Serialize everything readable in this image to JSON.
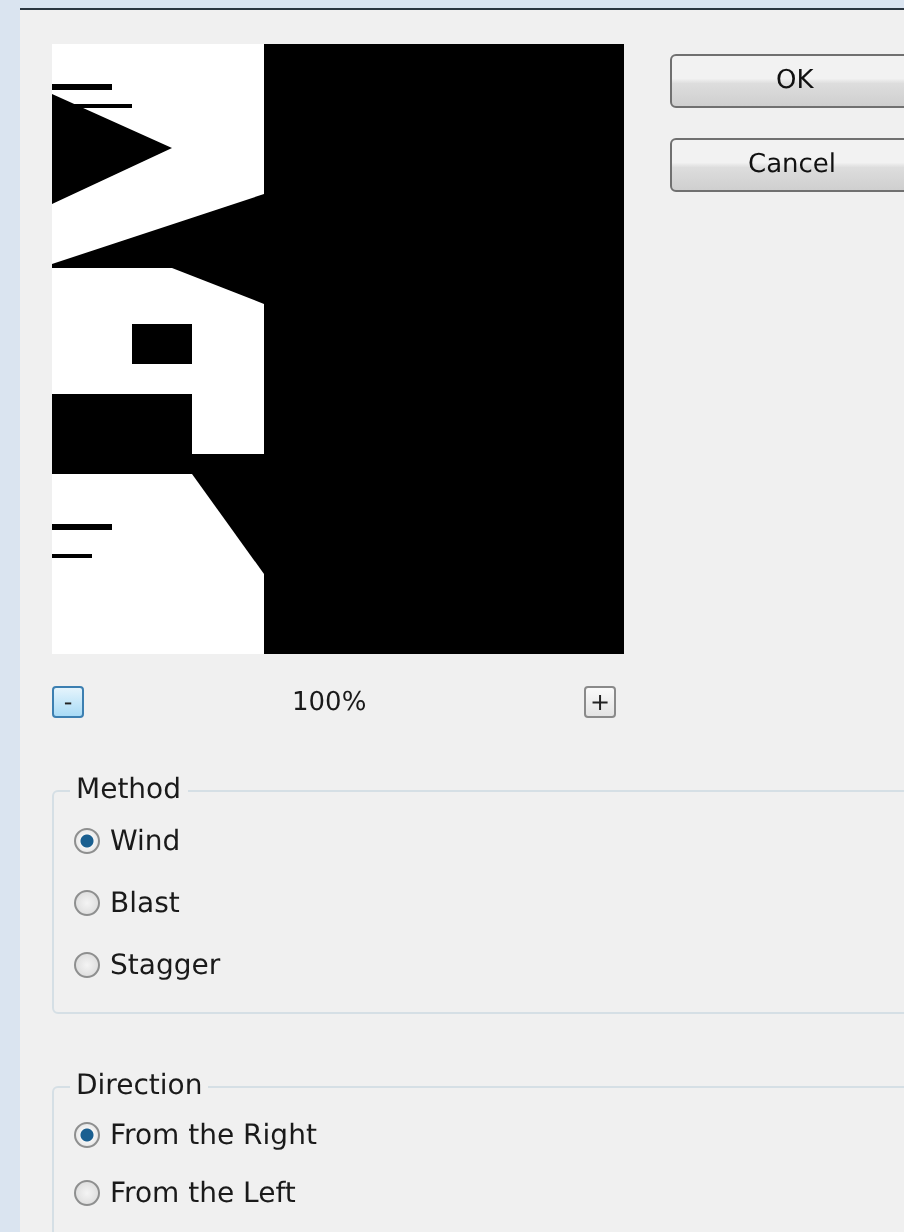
{
  "zoom": {
    "minus": {
      "label": "-",
      "highlighted": true
    },
    "value": "100%",
    "plus": {
      "label": "+",
      "highlighted": false
    }
  },
  "buttons": [
    {
      "label": "OK"
    },
    {
      "label": "Cancel"
    }
  ],
  "groups": [
    {
      "title": "Method",
      "options": [
        {
          "label": "Wind",
          "selected": true
        },
        {
          "label": "Blast",
          "selected": false
        },
        {
          "label": "Stagger",
          "selected": false
        }
      ]
    },
    {
      "title": "Direction",
      "options": [
        {
          "label": "From the Right",
          "selected": true
        },
        {
          "label": "From the Left",
          "selected": false
        }
      ]
    }
  ]
}
